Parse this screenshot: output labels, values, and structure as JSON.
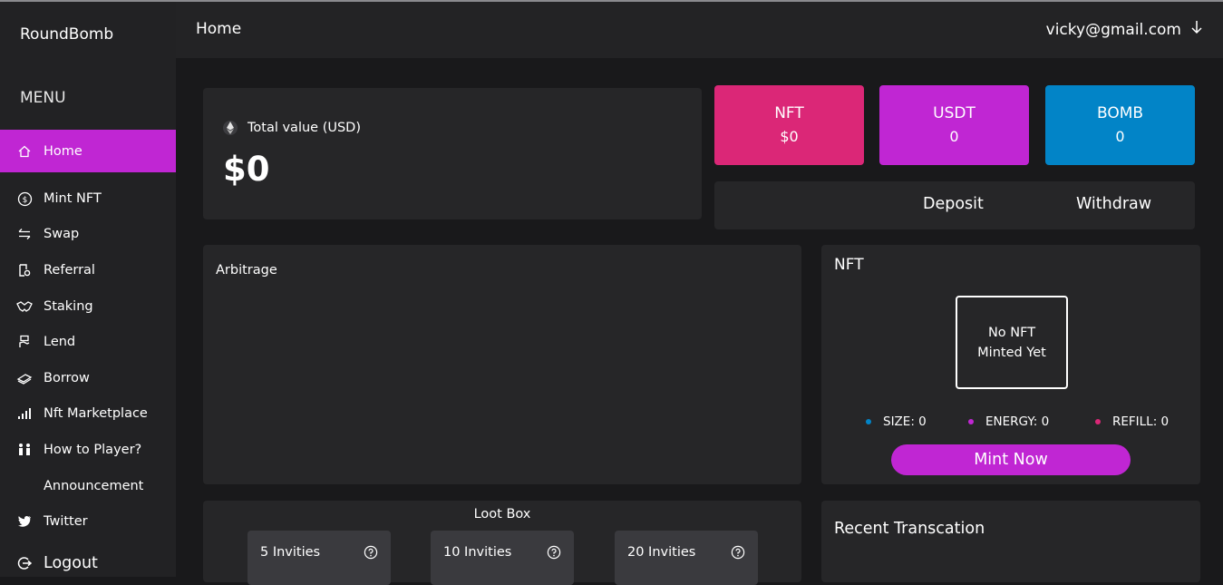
{
  "brand": "RoundBomb",
  "menu_title": "MENU",
  "nav": {
    "home": "Home",
    "mint_nft": "Mint NFT",
    "swap": "Swap",
    "referral": "Referral",
    "staking": "Staking",
    "lend": "Lend",
    "borrow": "Borrow",
    "nft_marketplace": "Nft Marketplace",
    "how_to": "How to Player?",
    "announcement": "Announcement",
    "twitter": "Twitter",
    "logout": "Logout"
  },
  "header": {
    "title": "Home",
    "user": "vicky@gmail.com"
  },
  "total": {
    "label": "Total value (USD)",
    "value": "$0"
  },
  "tokens": {
    "nft": {
      "name": "NFT",
      "value": "$0",
      "color": "#db2777"
    },
    "usdt": {
      "name": "USDT",
      "value": "0",
      "color": "#c026d3"
    },
    "bomb": {
      "name": "BOMB",
      "value": "0",
      "color": "#0284c7"
    }
  },
  "actions": {
    "deposit": "Deposit",
    "withdraw": "Withdraw"
  },
  "arbitrage": {
    "title": "Arbitrage"
  },
  "nft_panel": {
    "title": "NFT",
    "empty_line1": "No NFT",
    "empty_line2": "Minted Yet",
    "size": "SIZE: 0",
    "energy": "ENERGY: 0",
    "refill": "REFILL: 0",
    "mint_button": "Mint Now"
  },
  "loot": {
    "title": "Loot Box",
    "items": [
      "5 Invities",
      "10 Invities",
      "20 Invities"
    ]
  },
  "recent": {
    "title": "Recent Transcation"
  },
  "colors": {
    "accent": "#c026d3",
    "size_dot": "#0284c7",
    "energy_dot": "#c026d3",
    "refill_dot": "#db2777"
  }
}
